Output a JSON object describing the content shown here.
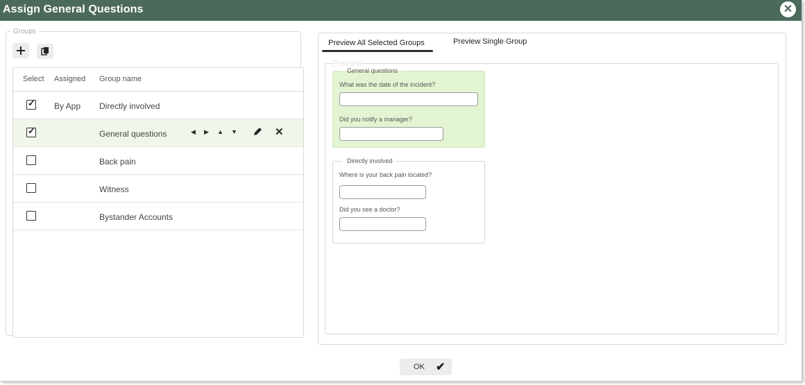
{
  "dialog": {
    "title": "Assign General Questions",
    "close_icon": "close-icon"
  },
  "groups_panel": {
    "legend": "Groups",
    "toolbar": {
      "add_icon": "plus-icon",
      "copy_icon": "copy-icon"
    },
    "columns": [
      "Select",
      "Assigned",
      "Group name"
    ],
    "rows": [
      {
        "checked": true,
        "assigned": "By App",
        "name": "Directly involved"
      },
      {
        "checked": true,
        "assigned": "",
        "name": "General questions",
        "selected": true
      },
      {
        "checked": false,
        "assigned": "",
        "name": "Back pain"
      },
      {
        "checked": false,
        "assigned": "",
        "name": "Witness"
      },
      {
        "checked": false,
        "assigned": "",
        "name": "Bystander Accounts"
      }
    ],
    "row_action_icons": [
      "triangle-left-icon",
      "triangle-right-icon",
      "triangle-up-icon",
      "triangle-down-icon",
      "pencil-icon",
      "delete-icon"
    ]
  },
  "preview_panel": {
    "tabs": [
      {
        "label": "Preview All Selected Groups",
        "active": true
      },
      {
        "label": "Preview Single Group",
        "active": false
      }
    ],
    "legend": "Preview",
    "groups": [
      {
        "title": "General questions",
        "highlighted": true,
        "questions": [
          "What was the date of the incident?",
          "Did you notify a manager?"
        ]
      },
      {
        "title": "Directly involved",
        "highlighted": false,
        "questions": [
          "Where is your back pain located?",
          "Did you see a doctor?"
        ]
      }
    ]
  },
  "footer": {
    "ok_label": "OK",
    "ok_icon": "checkmark-icon"
  },
  "colors": {
    "titlebar": "#4b6a5b",
    "highlight_group": "#e3f4d2",
    "selected_row": "#eff7ea"
  }
}
